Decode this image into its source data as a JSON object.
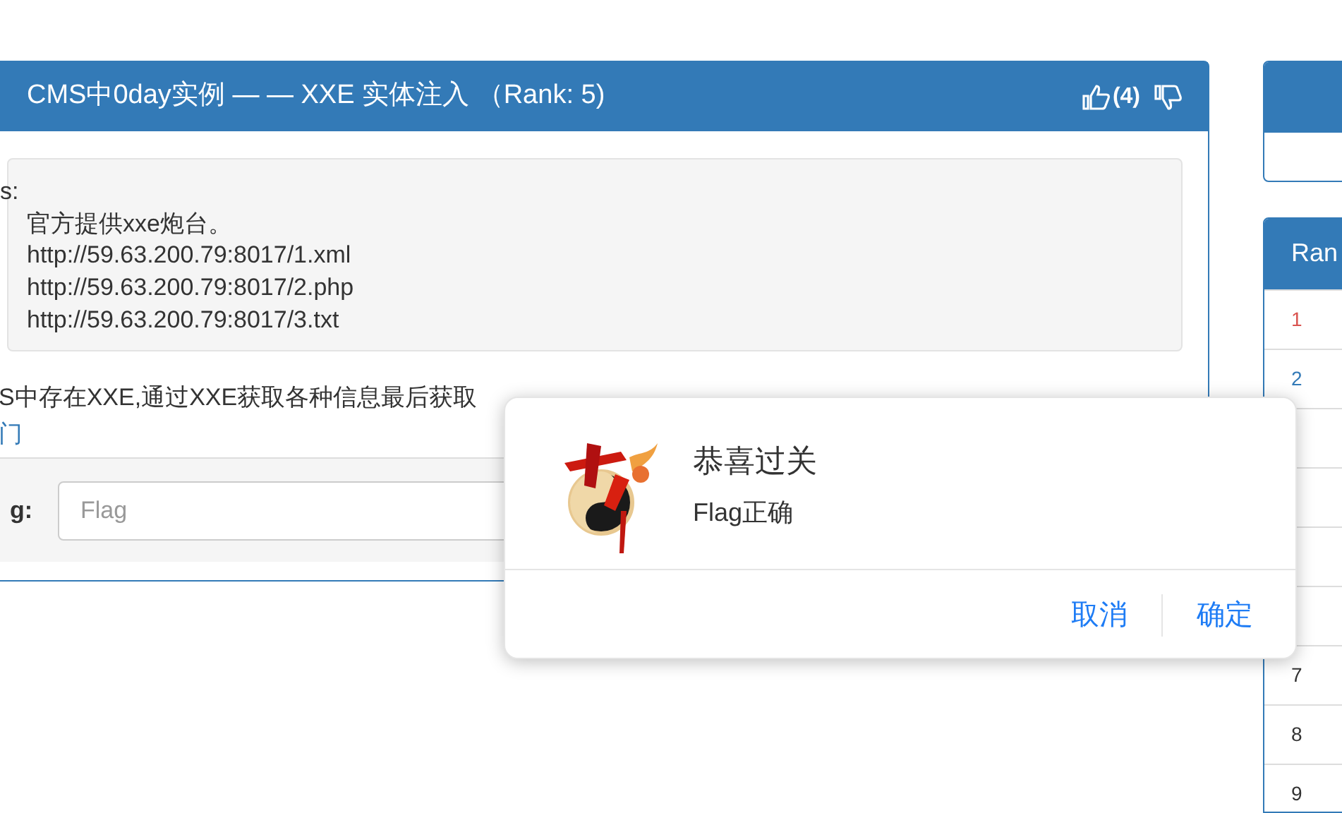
{
  "challenge": {
    "title": "CMS中0day实例 — — XXE 实体注入 （Rank: 5)",
    "likes": "(4)",
    "hints_label": "s:",
    "hints": [
      "官方提供xxe炮台。",
      "http://59.63.200.79:8017/1.xml",
      "http://59.63.200.79:8017/2.php",
      "http://59.63.200.79:8017/3.txt"
    ],
    "description": "S中存在XXE,通过XXE获取各种信息最后获取",
    "link": "门",
    "flag_label": "g:",
    "flag_placeholder": "Flag"
  },
  "rank_panel": {
    "title": "Ran",
    "rows": [
      {
        "rank": "1",
        "color": "#d9534f"
      },
      {
        "rank": "2",
        "color": "#337ab7"
      },
      {
        "rank": ""
      },
      {
        "rank": ""
      },
      {
        "rank": ""
      },
      {
        "rank": ""
      },
      {
        "rank": "7",
        "color": "#333333"
      },
      {
        "rank": "8",
        "color": "#333333"
      },
      {
        "rank": "9",
        "color": "#333333"
      }
    ]
  },
  "dialog": {
    "title": "恭喜过关",
    "message": "Flag正确",
    "buttons": [
      {
        "label": "取消"
      },
      {
        "label": "确定"
      }
    ]
  }
}
